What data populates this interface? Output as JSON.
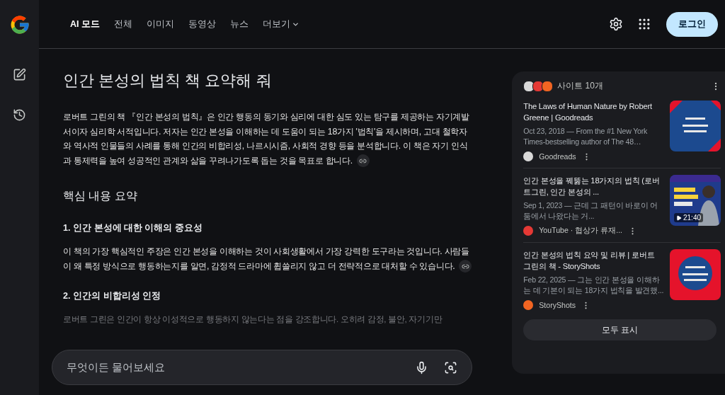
{
  "header": {
    "tabs": [
      {
        "label": "AI 모드",
        "selected": true,
        "kind": "tab"
      },
      {
        "label": "전체",
        "selected": false,
        "kind": "tab"
      },
      {
        "label": "이미지",
        "selected": false,
        "kind": "tab"
      },
      {
        "label": "동영상",
        "selected": false,
        "kind": "tab"
      },
      {
        "label": "뉴스",
        "selected": false,
        "kind": "tab"
      },
      {
        "label": "더보기",
        "selected": false,
        "kind": "menu"
      }
    ],
    "login": "로그인"
  },
  "answer": {
    "title": "인간 본성의 법칙 책 요약해 줘",
    "blocks": [
      {
        "kind": "paragraph",
        "text": "로버트 그린의 책 『인간 본성의 법칙』은 인간 행동의 동기와 심리에 대한 심도 있는 탐구를 제공하는 자기계발서이자 심리학 서적입니다. 저자는 인간 본성을 이해하는 데 도움이 되는 18가지 '법칙'을 제시하며, 고대 철학자와 역사적 인물들의 사례를 통해 인간의 비합리성, 나르시시즘, 사회적 경향 등을 분석합니다. 이 책은 자기 인식과 통제력을 높여 성공적인 관계와 삶을 꾸려나가도록 돕는 것을 목표로 합니다.",
        "cited": true
      },
      {
        "kind": "heading",
        "text": "핵심 내용 요약"
      },
      {
        "kind": "subheading",
        "text": "1. 인간 본성에 대한 이해의 중요성"
      },
      {
        "kind": "paragraph",
        "text": "이 책의 가장 핵심적인 주장은 인간 본성을 이해하는 것이 사회생활에서 가장 강력한 도구라는 것입니다. 사람들이 왜 특정 방식으로 행동하는지를 알면, 감정적 드라마에 휩쓸리지 않고 더 전략적으로 대처할 수 있습니다.",
        "cited": true
      },
      {
        "kind": "subheading",
        "text": "2. 인간의 비합리성 인정"
      },
      {
        "kind": "faded",
        "text": "로버트 그린은 인간이 항상 이성적으로 행동하지 않는다는 점을 강조합니다. 오히려 감정, 불안, 자기기만"
      }
    ]
  },
  "ask": {
    "placeholder": "무엇이든 물어보세요"
  },
  "sources": {
    "count": "사이트 10개",
    "results": [
      {
        "title": "The Laws of Human Nature by Robert Greene | Goodreads",
        "snippet": "Oct 23, 2018 — From the #1 New York Times-bestselling author of The 48…",
        "source": "Goodreads",
        "color": "#d9d9d9",
        "kind": "book-blue"
      },
      {
        "title": "인간 본성을 꿰뚫는 18가지의 법칙 (로버트그린, 인간 본성의 ...",
        "snippet": "Sep 1, 2023 — 근데 그 패턴이 바로이 어둠에서 나왔다는 거...",
        "source": "YouTube · 협상가 류재...",
        "color": "#e53935",
        "kind": "video",
        "duration": "21:40"
      },
      {
        "title": "인간 본성의 법칙 요약 및 리뷰 | 로버트 그린의 책 - StoryShots",
        "snippet": "Feb 22, 2025 — 그는 인간 본성을 이해하는 데 기본이 되는 18가지 법칙을 발견했...",
        "source": "StoryShots",
        "color": "#f26522",
        "kind": "book-red"
      }
    ],
    "show_all": "모두 표시"
  }
}
